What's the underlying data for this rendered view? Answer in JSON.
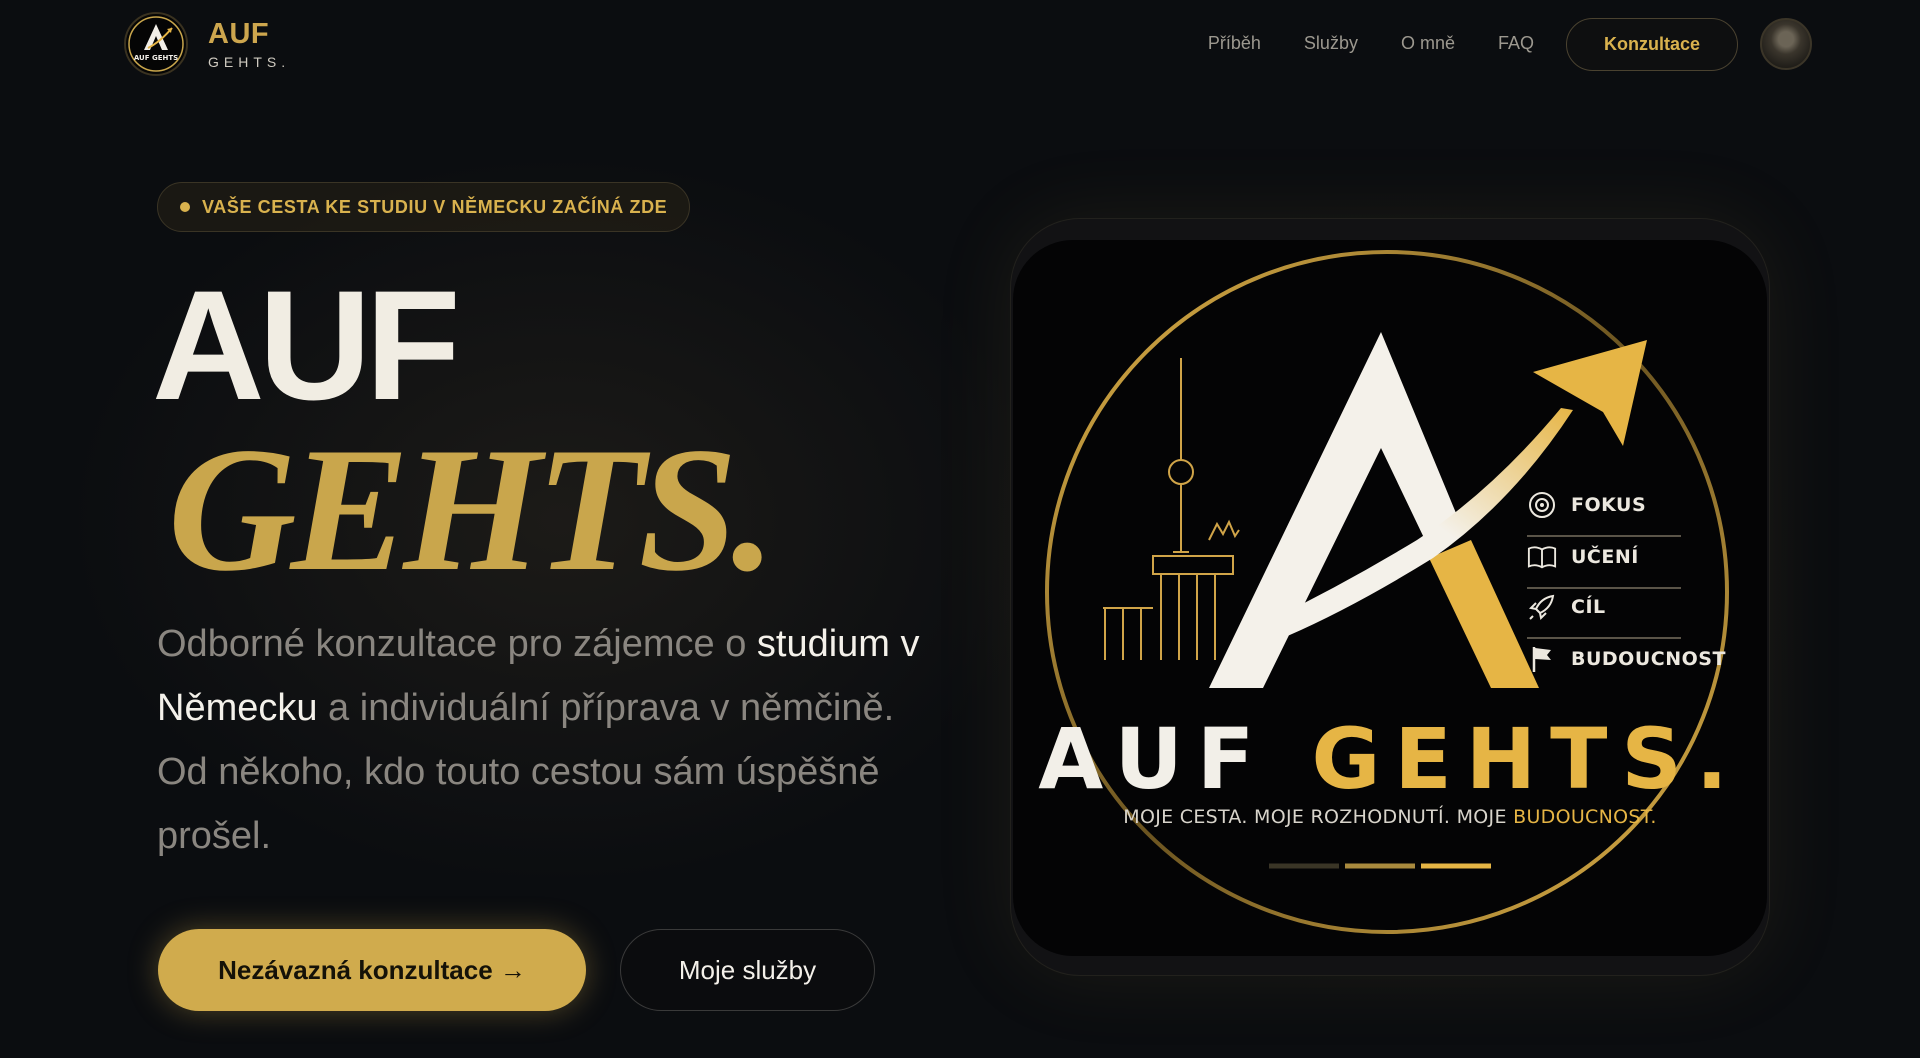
{
  "brand": {
    "name_top": "AUF",
    "name_bottom": "GEHTS.",
    "logo_mini_text": "AUF GEHTS"
  },
  "nav": {
    "links": [
      "Příběh",
      "Služby",
      "O mně",
      "FAQ"
    ],
    "cta_label": "Konzultace"
  },
  "hero": {
    "badge": "VAŠE CESTA KE STUDIU V NĚMECKU ZAČÍNÁ ZDE",
    "title_line1": "AUF",
    "title_line2": "GEHTS.",
    "desc_part1": "Odborné konzultace pro zájemce o ",
    "desc_highlight": "studium v Německu",
    "desc_part2": " a individuální příprava v němčině. Od někoho, kdo touto cestou sám úspěšně prošel.",
    "primary_button": "Nezávazná konzultace →",
    "secondary_button": "Moje služby"
  },
  "logo_card": {
    "word1": "AUF",
    "word2": "GEHTS.",
    "tagline_part1": "MOJE CESTA. MOJE ROZHODNUTÍ. MOJE ",
    "tagline_highlight": "BUDOUCNOST.",
    "pillars": [
      "FOKUS",
      "UČENÍ",
      "CÍL",
      "BUDOUCNOST"
    ]
  },
  "colors": {
    "background": "#0b0d10",
    "gold": "#d0ab4d",
    "text_light": "#f1ede3",
    "text_muted": "#8a8680"
  },
  "icons": [
    "target-icon",
    "book-icon",
    "rocket-icon",
    "flag-icon"
  ]
}
